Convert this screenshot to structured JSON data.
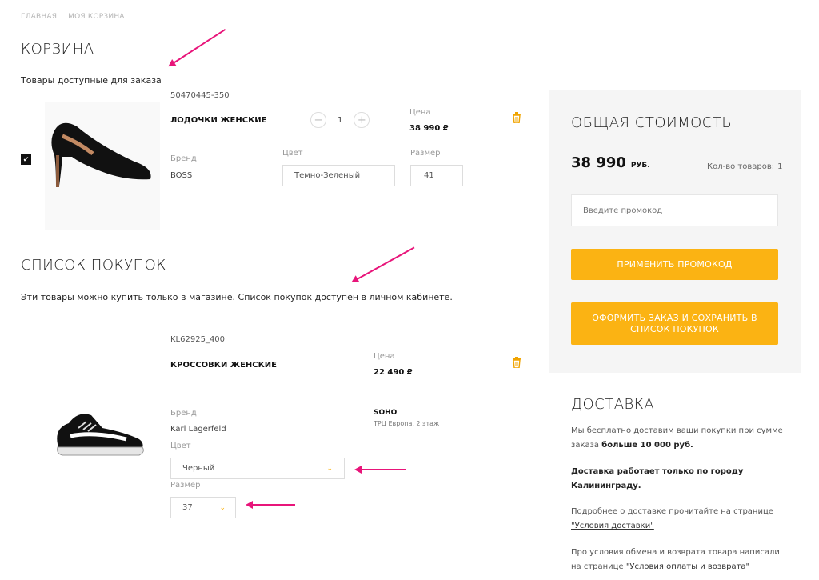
{
  "breadcrumb": [
    "ГЛАВНАЯ",
    "МОЯ КОРЗИНА"
  ],
  "cart": {
    "title": "КОРЗИНА",
    "subtitle": "Товары доступные для заказа",
    "item": {
      "sku": "50470445-350",
      "name": "ЛОДОЧКИ ЖЕНСКИЕ",
      "qty": "1",
      "qty_minus": "−",
      "qty_plus": "+",
      "price_label": "Цена",
      "price": "38 990 ₽",
      "brand_label": "Бренд",
      "brand": "BOSS",
      "color_label": "Цвет",
      "color": "Темно-Зеленый",
      "size_label": "Размер",
      "size": "41",
      "checked": "✔"
    }
  },
  "shopping_list": {
    "title": "СПИСОК ПОКУПОК",
    "subtitle": "Эти товары можно купить только в магазине. Список покупок доступен в личном кабинете.",
    "item": {
      "sku": "KL62925_400",
      "name": "КРОССОВКИ ЖЕНСКИЕ",
      "price_label": "Цена",
      "price": "22 490 ₽",
      "brand_label": "Бренд",
      "brand": "Karl Lagerfeld",
      "store": "SOHO",
      "store_address": "ТРЦ Европа, 2 этаж",
      "color_label": "Цвет",
      "color": "Черный",
      "size_label": "Размер",
      "size": "37"
    }
  },
  "summary": {
    "title": "ОБЩАЯ СТОИМОСТЬ",
    "total": "38 990",
    "currency": "РУБ.",
    "count_label": "Кол-во товаров:",
    "count": "1",
    "promo_placeholder": "Введите промокод",
    "apply_label": "ПРИМЕНИТЬ ПРОМОКОД",
    "checkout_label": "ОФОРМИТЬ ЗАКАЗ И СОХРАНИТЬ В СПИСОК ПОКУПОК"
  },
  "delivery": {
    "title": "ДОСТАВКА",
    "p1_a": "Мы бесплатно доставим ваши покупки при сумме заказа ",
    "p1_b": "больше 10 000 руб.",
    "p2": "Доставка работает только по городу Калининграду.",
    "p3_a": "Подробнее о доставке прочитайте на странице",
    "p3_link": "\"Условия доставки\"",
    "p4_a": "Про условия обмена и возврата товара написали на странице ",
    "p4_link": "\"Условия оплаты и возврата\""
  },
  "colors": {
    "accent": "#fbb313",
    "annotation": "#e8157a",
    "panel": "#f5f5f5"
  }
}
